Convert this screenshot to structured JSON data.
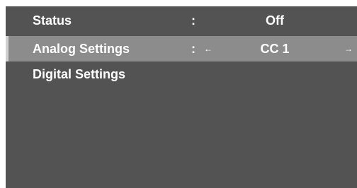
{
  "menu": {
    "rows": [
      {
        "label": "Status",
        "separator": ":",
        "value": "Off"
      },
      {
        "label": "Analog Settings",
        "separator": ":",
        "value": "CC 1",
        "left_arrow": "←",
        "right_arrow": "→"
      },
      {
        "label": "Digital Settings"
      }
    ]
  },
  "colors": {
    "panel_background": "#535353",
    "selected_row_background": "#8c8c8c",
    "text": "#ffffff"
  }
}
